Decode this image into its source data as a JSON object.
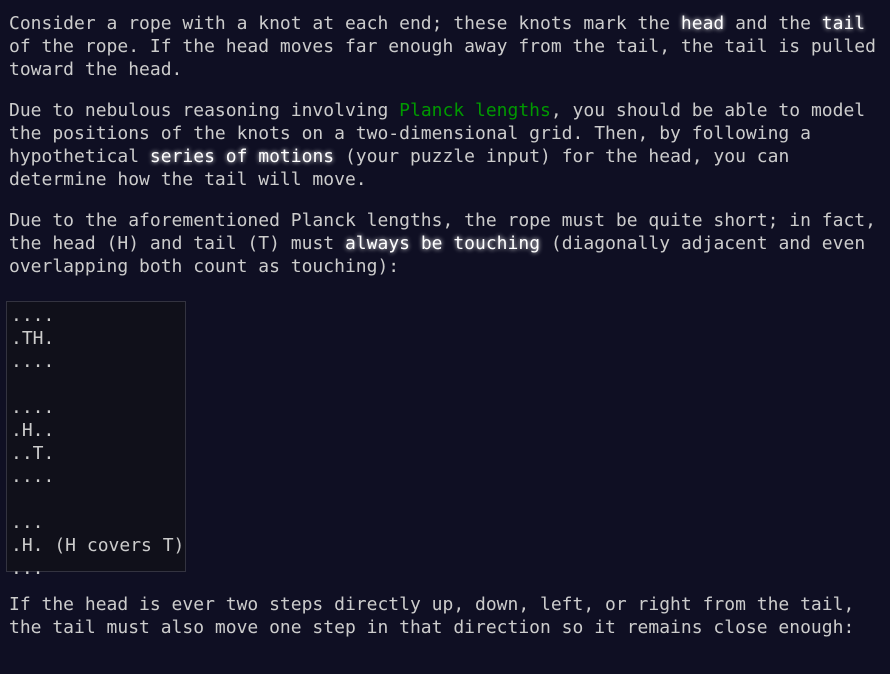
{
  "paragraph1": {
    "t1": "Consider a rope with a knot at each end; these knots mark the ",
    "head": "head",
    "t2": " and the ",
    "tail": "tail",
    "t3": " of the rope. If the head moves far enough away from the tail, the tail is pulled toward the head."
  },
  "paragraph2": {
    "t1": "Due to nebulous reasoning involving ",
    "planck_link": "Planck lengths",
    "t2": ", you should be able to model the positions of the knots on a two-dimensional grid. Then, by following a hypothetical ",
    "series": "series of motions",
    "t3": " (your puzzle input) for the head, you can determine how the tail will move."
  },
  "paragraph3": {
    "t1": "Due to the aforementioned Planck lengths, the rope must be quite short; in fact, the head (",
    "H": "H",
    "t2": ") and tail (",
    "T": "T",
    "t3": ") must ",
    "always": "always be touching",
    "t4": " (diagonally adjacent and even overlapping both count as touching):"
  },
  "code_block": "....\n.TH.\n....\n\n....\n.H..\n..T.\n....\n\n...\n.H. (H covers T)\n...",
  "paragraph4": {
    "text": "If the head is ever two steps directly up, down, left, or right from the tail, the tail must also move one step in that direction so it remains close enough:"
  },
  "colors": {
    "background": "#0f0f23",
    "text": "#cccccc",
    "emphasis": "#ffffff",
    "link": "#009900",
    "code_background": "#10101a",
    "code_border": "#333340"
  }
}
